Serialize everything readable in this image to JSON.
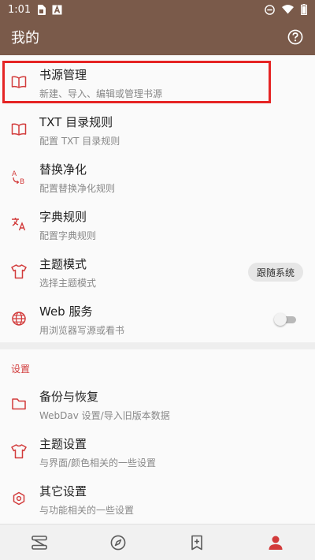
{
  "status_bar": {
    "time": "1:01",
    "icons": [
      "sim-card-icon",
      "font-a-icon",
      "do-not-disturb-icon",
      "wifi-icon",
      "battery-icon"
    ]
  },
  "app_bar": {
    "title": "我的",
    "help_icon": "help-circle-icon"
  },
  "menu": [
    {
      "id": "book-source",
      "icon": "book-open-icon",
      "title": "书源管理",
      "subtitle": "新建、导入、编辑或管理书源",
      "highlighted": true
    },
    {
      "id": "txt-toc-rule",
      "icon": "book-open-icon",
      "title": "TXT 目录规则",
      "subtitle": "配置 TXT 目录规则"
    },
    {
      "id": "replace-rule",
      "icon": "replace-ab-icon",
      "title": "替换净化",
      "subtitle": "配置替换净化规则"
    },
    {
      "id": "dict-rule",
      "icon": "translate-icon",
      "title": "字典规则",
      "subtitle": "配置字典规则"
    },
    {
      "id": "theme-mode",
      "icon": "tshirt-icon",
      "title": "主题模式",
      "subtitle": "选择主题模式",
      "value": "跟随系统"
    },
    {
      "id": "web-service",
      "icon": "globe-icon",
      "title": "Web 服务",
      "subtitle": "用浏览器写源或看书",
      "toggle": false
    }
  ],
  "settings_section": {
    "label": "设置",
    "items": [
      {
        "id": "backup",
        "icon": "folder-icon",
        "title": "备份与恢复",
        "subtitle": "WebDav 设置/导入旧版本数据"
      },
      {
        "id": "theme-setting",
        "icon": "tshirt-icon",
        "title": "主题设置",
        "subtitle": "与界面/颜色相关的一些设置"
      },
      {
        "id": "other-setting",
        "icon": "hexagon-gear-icon",
        "title": "其它设置",
        "subtitle": "与功能相关的一些设置"
      }
    ]
  },
  "bottom_nav": [
    {
      "id": "bookshelf",
      "icon": "bookshelf-icon",
      "active": false
    },
    {
      "id": "discover",
      "icon": "compass-icon",
      "active": false
    },
    {
      "id": "rss",
      "icon": "bookmark-add-icon",
      "active": false
    },
    {
      "id": "my",
      "icon": "person-icon",
      "active": true
    }
  ],
  "colors": {
    "app_bar": "#7a5a4a",
    "accent": "#d23b3b",
    "highlight_border": "#e52424",
    "nav_active": "#d23b3b",
    "nav_inactive": "#5a5a5a"
  }
}
